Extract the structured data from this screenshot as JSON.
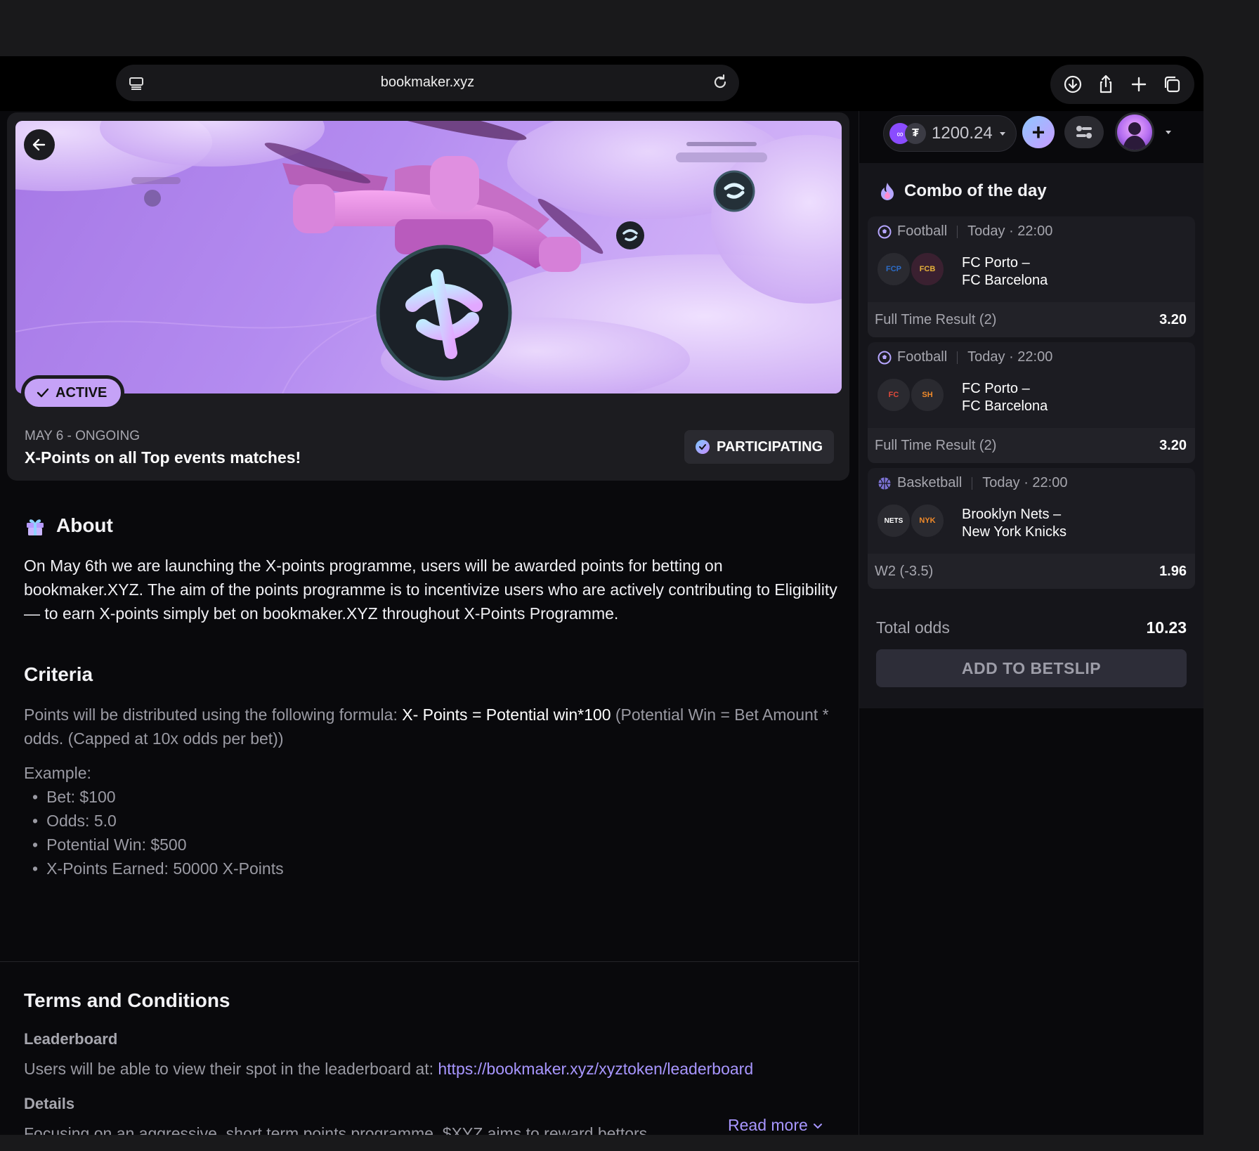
{
  "browser": {
    "url": "bookmaker.xyz"
  },
  "promo": {
    "status": "ACTIVE",
    "date": "MAY 6 - ONGOING",
    "title": "X-Points on all Top events matches!",
    "participating": "PARTICIPATING"
  },
  "about": {
    "heading": "About",
    "text": "On May 6th we are launching the X-points programme, users will be awarded points for betting on bookmaker.XYZ. The aim of the points programme is to incentivize users who are actively contributing to Eligibility — to earn X-points simply bet on bookmaker.XYZ throughout X-Points Programme."
  },
  "criteria": {
    "heading": "Criteria",
    "intro": "Points will be distributed using the following formula: ",
    "formula": "X- Points = Potential win*100",
    "note": " (Potential Win = Bet Amount * odds. (Capped at 10x odds per bet))",
    "example_label": "Example:",
    "example_items": [
      "Bet: $100",
      "Odds: 5.0",
      "Potential Win: $500",
      "X-Points Earned: 50000 X-Points"
    ]
  },
  "terms": {
    "heading": "Terms and Conditions",
    "leaderboard_heading": "Leaderboard",
    "leaderboard_text": "Users will be able to view their spot in the leaderboard at: ",
    "leaderboard_link": "https://bookmaker.xyz/xyztoken/leaderboard",
    "details_heading": "Details",
    "details_text": "Focusing on an aggressive, short term points programme, $XYZ aims to reward bettors, ...",
    "read_more": "Read more"
  },
  "wallet": {
    "balance": "1200.24",
    "plus": "+"
  },
  "combo": {
    "heading": "Combo of the day",
    "matches": [
      {
        "sport": "Football",
        "time": "Today · 22:00",
        "team1": "FC Porto –",
        "team2": "FC Barcelona",
        "market": "Full Time Result (2)",
        "odds": "3.20",
        "logo1": "FCP",
        "logo2": "FCB"
      },
      {
        "sport": "Football",
        "time": "Today · 22:00",
        "team1": "FC Porto –",
        "team2": "FC Barcelona",
        "market": "Full Time Result (2)",
        "odds": "3.20",
        "logo1": "FC",
        "logo2": "SH"
      },
      {
        "sport": "Basketball",
        "time": "Today · 22:00",
        "team1": "Brooklyn Nets –",
        "team2": "New York Knicks",
        "market": "W2 (-3.5)",
        "odds": "1.96",
        "logo1": "NETS",
        "logo2": "NYK"
      }
    ],
    "total_label": "Total odds",
    "total_value": "10.23",
    "button": "ADD TO BETSLIP"
  },
  "colors": {
    "accent": "#a896ff",
    "badge": "#c5a2f7",
    "background": "#09090c"
  }
}
